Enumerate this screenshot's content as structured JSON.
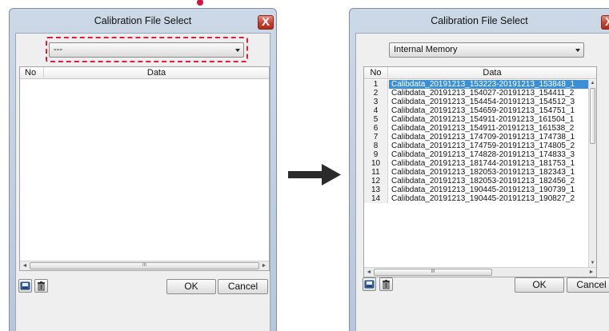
{
  "left_dialog": {
    "title": "Calibration File Select",
    "close_label": "X",
    "combo_value": "---",
    "columns": {
      "no": "No",
      "data": "Data"
    },
    "scroll_grip": "III",
    "ok_label": "OK",
    "cancel_label": "Cancel"
  },
  "right_dialog": {
    "title": "Calibration File Select",
    "close_label": "X",
    "combo_value": "Internal Memory",
    "columns": {
      "no": "No",
      "data": "Data"
    },
    "scroll_grip": "III",
    "ok_label": "OK",
    "cancel_label": "Cancel",
    "rows": [
      {
        "no": "1",
        "data": "Calibdata_20191213_153223-20191213_153848_1"
      },
      {
        "no": "2",
        "data": "Calibdata_20191213_154027-20191213_154411_2"
      },
      {
        "no": "3",
        "data": "Calibdata_20191213_154454-20191213_154512_3"
      },
      {
        "no": "4",
        "data": "Calibdata_20191213_154659-20191213_154751_1"
      },
      {
        "no": "5",
        "data": "Calibdata_20191213_154911-20191213_161504_1"
      },
      {
        "no": "6",
        "data": "Calibdata_20191213_154911-20191213_161538_2"
      },
      {
        "no": "7",
        "data": "Calibdata_20191213_174709-20191213_174738_1"
      },
      {
        "no": "8",
        "data": "Calibdata_20191213_174759-20191213_174805_2"
      },
      {
        "no": "9",
        "data": "Calibdata_20191213_174828-20191213_174833_3"
      },
      {
        "no": "10",
        "data": "Calibdata_20191213_181744-20191213_181753_1"
      },
      {
        "no": "11",
        "data": "Calibdata_20191213_182053-20191213_182343_1"
      },
      {
        "no": "12",
        "data": "Calibdata_20191213_182053-20191213_182456_2"
      },
      {
        "no": "13",
        "data": "Calibdata_20191213_190445-20191213_190739_1"
      },
      {
        "no": "14",
        "data": "Calibdata_20191213_190445-20191213_190827_2"
      }
    ]
  },
  "colors": {
    "highlight_dash": "#e0203b",
    "selection": "#3a8fd6",
    "transition_arrow": "#2b2b2b"
  }
}
